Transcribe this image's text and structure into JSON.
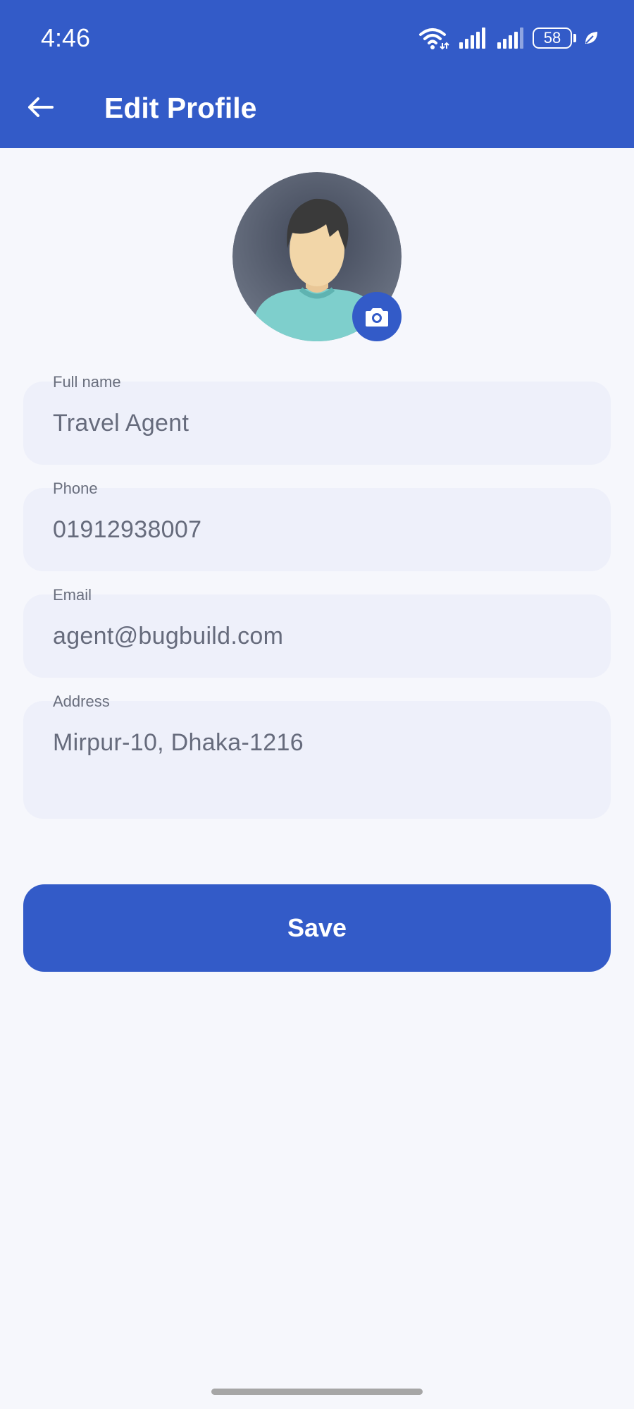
{
  "status_bar": {
    "time": "4:46",
    "battery_level": "58",
    "icons": [
      "wifi-icon",
      "signal-icon",
      "signal-icon",
      "battery-icon",
      "leaf-icon"
    ]
  },
  "header": {
    "title": "Edit Profile",
    "back_icon": "arrow-left-icon"
  },
  "profile": {
    "avatar_icon": "avatar-placeholder",
    "camera_icon": "camera-icon"
  },
  "form": {
    "full_name": {
      "label": "Full name",
      "value": "Travel Agent"
    },
    "phone": {
      "label": "Phone",
      "value": "01912938007"
    },
    "email": {
      "label": "Email",
      "value": "agent@bugbuild.com"
    },
    "address": {
      "label": "Address",
      "value": "Mirpur-10, Dhaka-1216"
    }
  },
  "actions": {
    "save_label": "Save"
  },
  "colors": {
    "primary": "#335bc8",
    "background": "#f6f7fc",
    "field_background": "#eef0fa",
    "text_muted": "#666b7c"
  }
}
